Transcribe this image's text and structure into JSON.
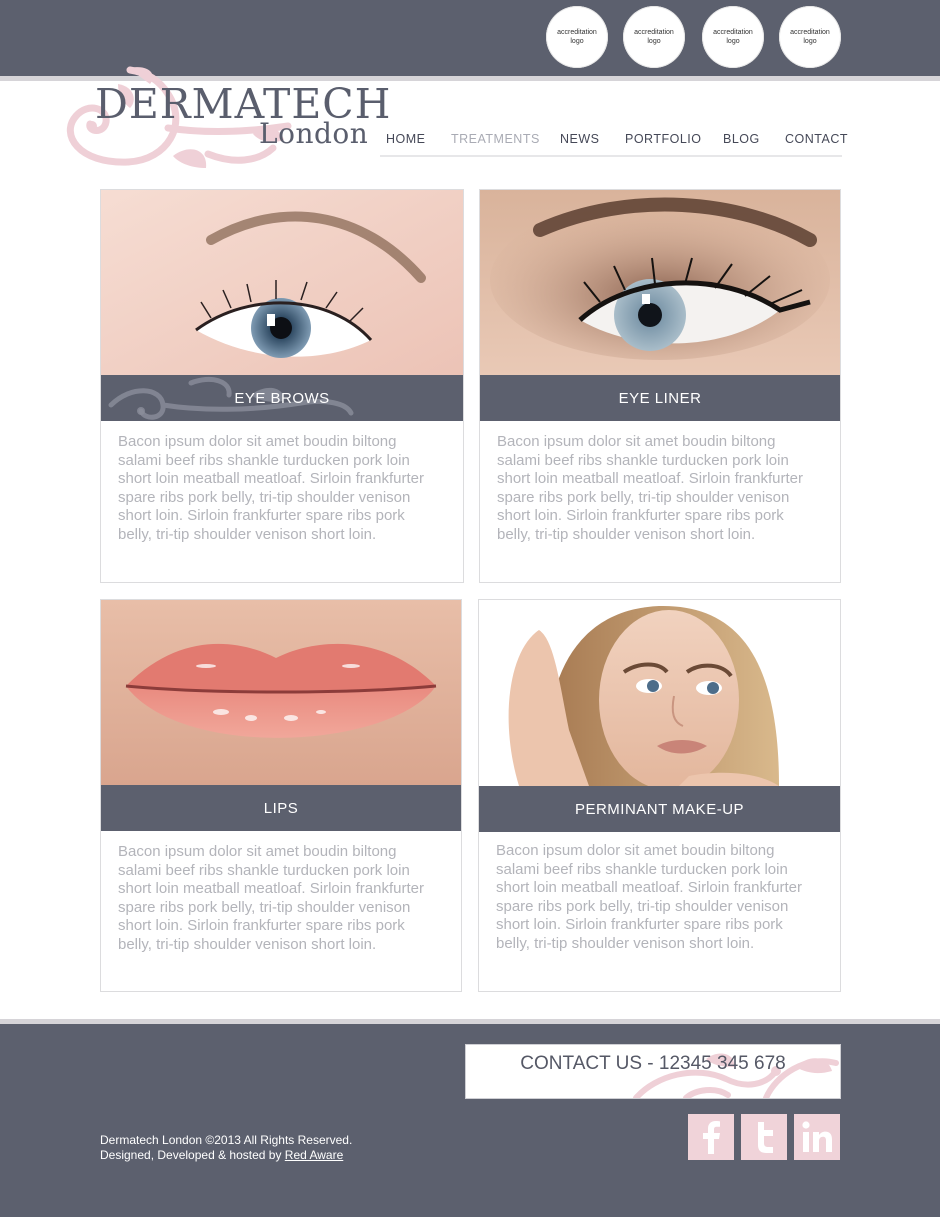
{
  "header": {
    "accreditation_logos": [
      "accreditation logo",
      "accreditation logo",
      "accreditation logo",
      "accreditation logo"
    ]
  },
  "logo": {
    "line1": "DERMATECH",
    "line2": "London"
  },
  "nav": {
    "items": [
      {
        "label": "HOME",
        "active": false
      },
      {
        "label": "TREATMENTS",
        "active": true
      },
      {
        "label": "NEWS",
        "active": false
      },
      {
        "label": "PORTFOLIO",
        "active": false
      },
      {
        "label": "BLOG",
        "active": false
      },
      {
        "label": "CONTACT",
        "active": false
      }
    ]
  },
  "cards": [
    {
      "title": "EYE BROWS",
      "body": "Bacon ipsum dolor sit amet boudin biltong salami beef ribs shankle turducken pork loin short loin meatball meatloaf. Sirloin frankfurter spare ribs pork belly, tri-tip shoulder venison short loin. Sirloin frankfurter spare ribs pork belly, tri-tip shoulder venison short loin."
    },
    {
      "title": "EYE LINER",
      "body": "Bacon ipsum dolor sit amet boudin biltong salami beef ribs shankle turducken pork loin short loin meatball meatloaf. Sirloin frankfurter spare ribs pork belly, tri-tip shoulder venison short loin. Sirloin frankfurter spare ribs pork belly, tri-tip shoulder venison short loin."
    },
    {
      "title": "LIPS",
      "body": "Bacon ipsum dolor sit amet boudin biltong salami beef ribs shankle turducken pork loin short loin meatball meatloaf. Sirloin frankfurter spare ribs pork belly, tri-tip shoulder venison short loin. Sirloin frankfurter spare ribs pork belly, tri-tip shoulder venison short loin."
    },
    {
      "title": "PERMINANT MAKE-UP",
      "body": "Bacon ipsum dolor sit amet boudin biltong salami beef ribs shankle turducken pork loin short loin meatball meatloaf. Sirloin frankfurter spare ribs pork belly, tri-tip shoulder venison short loin. Sirloin frankfurter spare ribs pork belly, tri-tip shoulder venison short loin."
    }
  ],
  "footer": {
    "contact": "CONTACT US - 12345 345 678",
    "copyright_line1": "Dermatech London ©2013 All Rights Reserved.",
    "copyright_prefix": "Designed, Developed & hosted by ",
    "credit_link": "Red Aware",
    "social": [
      {
        "icon": "facebook-icon",
        "glyph": "f"
      },
      {
        "icon": "twitter-icon",
        "glyph": "t"
      },
      {
        "icon": "linkedin-icon",
        "glyph": "in"
      }
    ]
  },
  "colors": {
    "header_bg": "#5c606e",
    "accent_pink": "#f0d3d9",
    "nav_active": "#a9abb4",
    "body_text": "#b3b4ba"
  }
}
